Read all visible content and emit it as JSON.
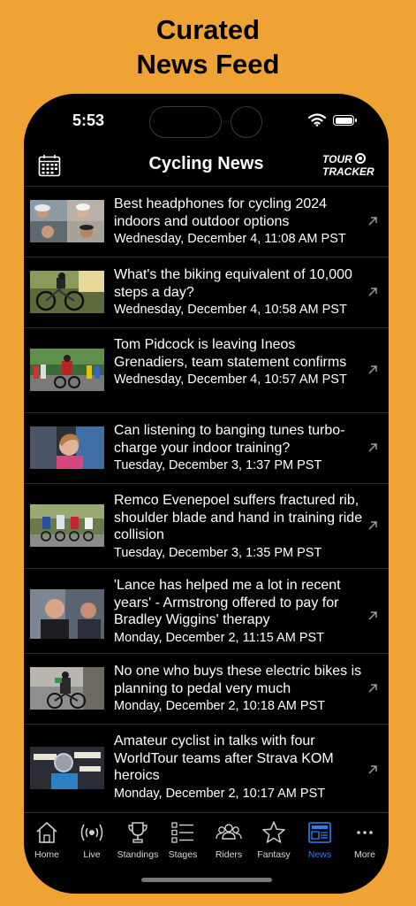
{
  "promo": {
    "line1": "Curated",
    "line2": "News Feed",
    "background_color": "#F0A335"
  },
  "status_bar": {
    "time": "5:53",
    "icons": [
      "wifi-icon",
      "battery-icon"
    ]
  },
  "header": {
    "title": "Cycling News",
    "left_icon": "calendar-icon",
    "logo_line1": "TOUR",
    "logo_line2": "TRACKER"
  },
  "articles": [
    {
      "title": "Best headphones for cycling 2024 indoors and outdoor options",
      "date": "Wednesday, December 4, 11:08 AM PST",
      "icon": "external-link-icon"
    },
    {
      "title": "What's the biking equivalent of 10,000 steps a day?",
      "date": "Wednesday, December 4, 10:58 AM PST",
      "icon": "external-link-icon"
    },
    {
      "title": "Tom Pidcock is leaving Ineos Grenadiers, team statement confirms",
      "date": "Wednesday, December 4, 10:57 AM PST",
      "icon": "external-link-icon"
    },
    {
      "title": "Can listening to banging tunes turbo-charge your indoor training?",
      "date": "Tuesday, December 3, 1:37 PM PST",
      "icon": "external-link-icon"
    },
    {
      "title": "Remco Evenepoel suffers fractured rib, shoulder blade and hand in training ride collision",
      "date": "Tuesday, December 3, 1:35 PM PST",
      "icon": "external-link-icon"
    },
    {
      "title": "'Lance has helped me a lot in recent years' - Armstrong offered to pay for Bradley Wiggins' therapy",
      "date": "Monday, December 2, 11:15 AM PST",
      "icon": "external-link-icon"
    },
    {
      "title": "No one who buys these electric bikes is planning to pedal very much",
      "date": "Monday, December 2, 10:18 AM PST",
      "icon": "external-link-icon"
    },
    {
      "title": "Amateur cyclist in talks with four WorldTour teams after Strava KOM heroics",
      "date": "Monday, December 2, 10:17 AM PST",
      "icon": "external-link-icon"
    }
  ],
  "tabs": [
    {
      "label": "Home",
      "icon": "home-icon"
    },
    {
      "label": "Live",
      "icon": "broadcast-icon"
    },
    {
      "label": "Standings",
      "icon": "trophy-icon"
    },
    {
      "label": "Stages",
      "icon": "list-icon"
    },
    {
      "label": "Riders",
      "icon": "group-icon"
    },
    {
      "label": "Fantasy",
      "icon": "star-icon"
    },
    {
      "label": "News",
      "icon": "newspaper-icon",
      "active": true
    },
    {
      "label": "More",
      "icon": "ellipsis-icon"
    }
  ],
  "colors": {
    "accent": "#2f7df6",
    "app_background": "#000000"
  }
}
